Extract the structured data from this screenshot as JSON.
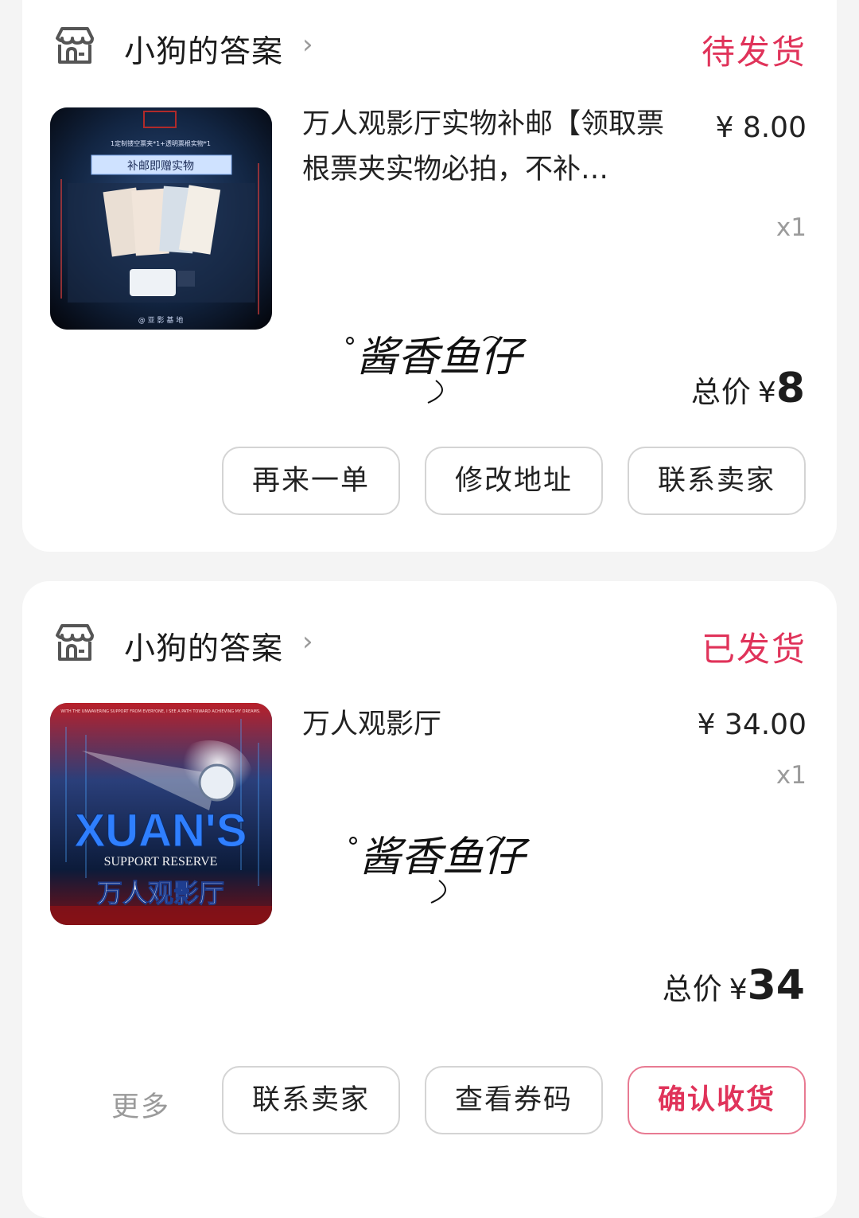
{
  "orders": [
    {
      "shop_name": "小狗的答案",
      "status": "待发货",
      "product_title": "万人观影厅实物补邮【领取票根票夹实物必拍，不补…",
      "price": "¥ 8.00",
      "qty": "x1",
      "total_label": "总价",
      "total_currency": "¥",
      "total_amount": "8",
      "thumb_texts": {
        "line1": "1定制镂空票夹*1+透明票根实物*1",
        "banner": "补邮即赠实物",
        "footer": "@ 亚 影 基 地"
      },
      "buttons": [
        "再来一单",
        "修改地址",
        "联系卖家"
      ]
    },
    {
      "shop_name": "小狗的答案",
      "status": "已发货",
      "product_title": "万人观影厅",
      "price": "¥ 34.00",
      "qty": "x1",
      "total_label": "总价",
      "total_currency": "¥",
      "total_amount": "34",
      "thumb_texts": {
        "top": "WITH THE UNWAVERING SUPPORT FROM EVERYONE, I SEE A PATH TOWARD ACHIEVING MY DREAMS.",
        "big": "XUAN'S",
        "sub": "SUPPORT RESERVE",
        "cn": "万人观影厅"
      },
      "more_label": "更多",
      "buttons": [
        "联系卖家",
        "查看券码",
        "确认收货"
      ]
    }
  ],
  "watermark": "酱香鱼仔",
  "colors": {
    "accent": "#e0335a",
    "card": "#ffffff",
    "background": "#f4f4f4"
  },
  "icons": {
    "shop": "shop-icon",
    "chevron": "chevron-right-icon"
  }
}
